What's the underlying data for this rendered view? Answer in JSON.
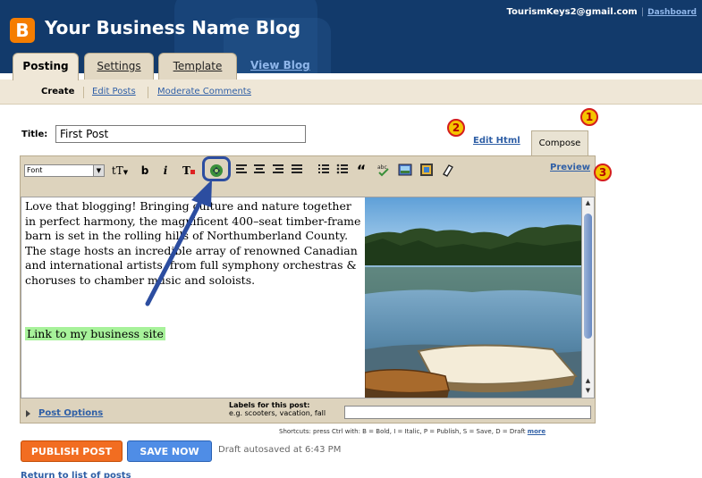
{
  "header": {
    "logo_letter": "B",
    "blog_title": "Your Business Name Blog",
    "user_email": "TourismKeys2@gmail.com",
    "separator": "|",
    "dashboard_link": "Dashboard"
  },
  "tabs": {
    "posting": "Posting",
    "settings": "Settings",
    "template": "Template",
    "view_blog": "View Blog"
  },
  "subnav": {
    "create": "Create",
    "edit_posts": "Edit Posts",
    "moderate_comments": "Moderate Comments"
  },
  "post": {
    "title_label": "Title:",
    "title_value": "First Post",
    "edit_html_tab": "Edit Html",
    "compose_tab": "Compose",
    "preview_link": "Preview",
    "body_text": "Love that blogging! Bringing culture and nature together in perfect harmony, the magnificent 400–seat timber-frame barn is set in the rolling hills of Northumberland County. The stage hosts an incredible array of renowned Canadian and international artists, from full symphony orchestras & choruses to chamber music and soloists.",
    "link_text": "Link to my business site"
  },
  "toolbar": {
    "font_select": "Font",
    "size_icon": "tT",
    "bold": "b",
    "italic": "i",
    "text_color": "T",
    "icon_names": [
      "text-color-icon",
      "link-icon",
      "align-left-icon",
      "align-center-icon",
      "align-right-icon",
      "justify-icon",
      "numbered-list-icon",
      "bullet-list-icon",
      "blockquote-icon",
      "spell-check-icon",
      "add-image-icon",
      "add-video-icon",
      "remove-formatting-icon"
    ]
  },
  "footer": {
    "post_options": "Post Options",
    "labels_title": "Labels for this post:",
    "labels_hint": "e.g. scooters, vacation, fall",
    "labels_value": "",
    "shortcuts_text": "Shortcuts: press Ctrl with: B = Bold, I = Italic, P = Publish, S = Save, D = Draft",
    "shortcuts_more": "more",
    "publish_button": "PUBLISH POST",
    "save_button": "SAVE NOW",
    "autosave_status": "Draft autosaved at 6:43 PM",
    "return_link": "Return to list of posts"
  },
  "callouts": {
    "one": "1",
    "two": "2",
    "three": "3"
  },
  "colors": {
    "header_bg": "#123a6b",
    "tab_bg": "#efe7d7",
    "publish": "#f26d21",
    "save": "#4f8de6",
    "link": "#2f5fa6",
    "callout_fill": "#f5c400",
    "callout_border": "#d41d1d",
    "annotation_arrow": "#2c4da0"
  }
}
